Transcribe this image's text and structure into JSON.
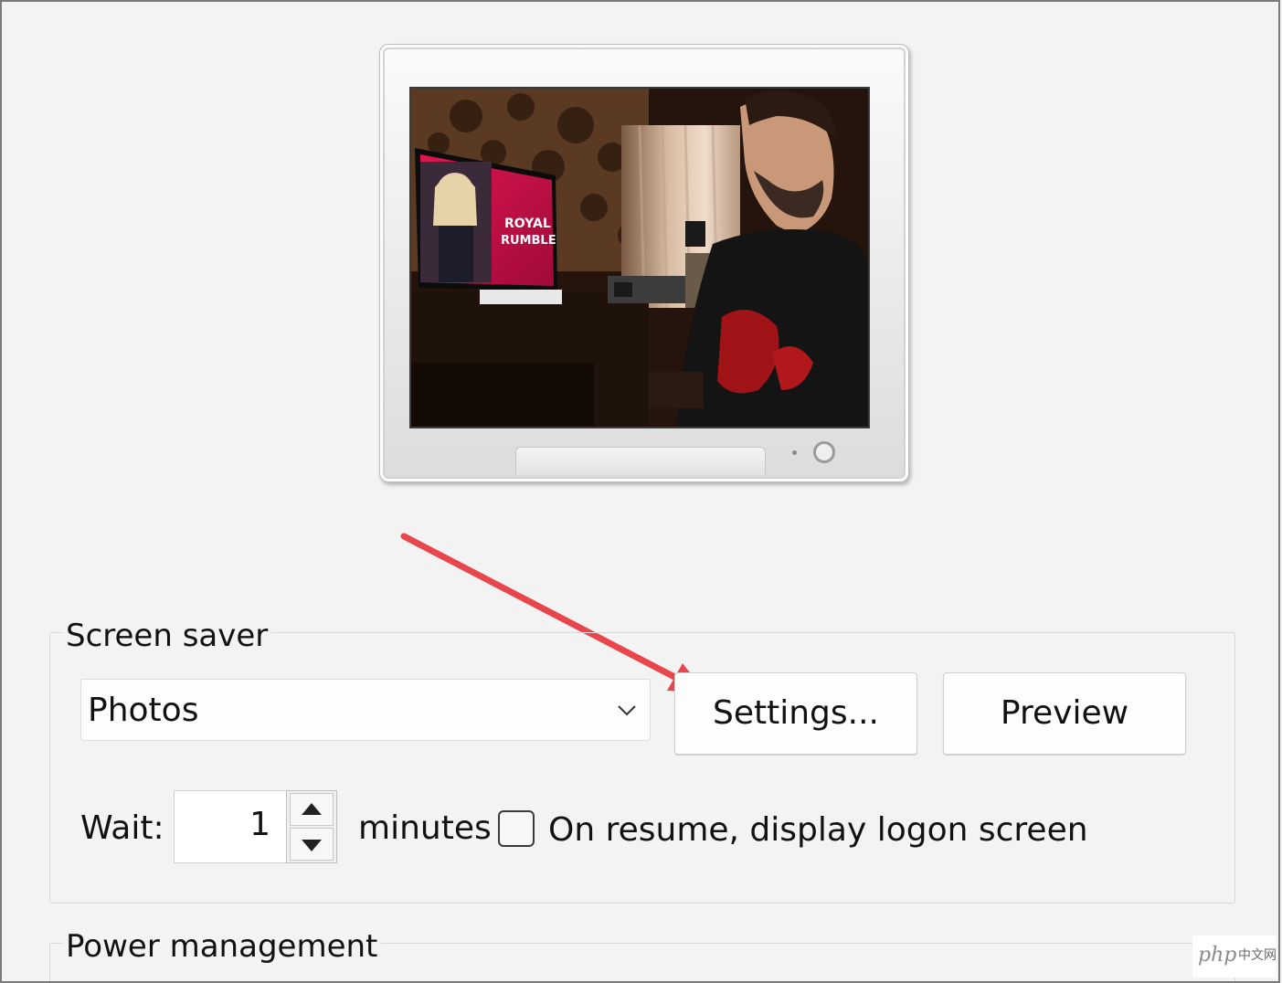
{
  "screen_saver": {
    "group_label": "Screen saver",
    "selected": "Photos",
    "settings_label": "Settings...",
    "preview_label": "Preview",
    "wait_label": "Wait:",
    "wait_value": "1",
    "minutes_label": "minutes",
    "logon_checkbox_label": "On resume, display logon screen",
    "logon_checked": false
  },
  "power_management": {
    "group_label": "Power management"
  },
  "preview_screen": {
    "tv_text_1": "ROYAL",
    "tv_text_2": "RUMBLE"
  },
  "watermark": {
    "brand": "php",
    "suffix": "中文网"
  },
  "colors": {
    "annotation_arrow": "#e8464c",
    "window_bg": "#f3f3f3"
  }
}
